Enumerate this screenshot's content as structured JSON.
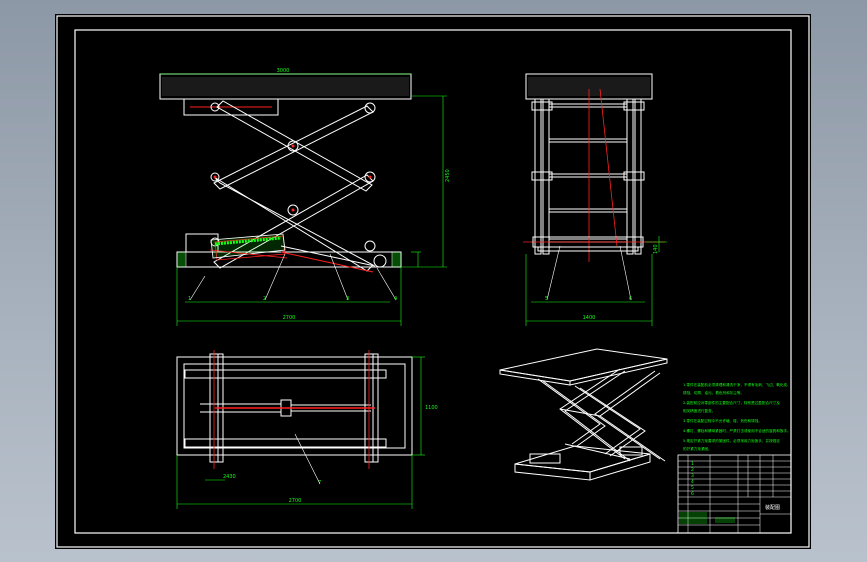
{
  "drawing": {
    "background": "#000000",
    "line_colors": {
      "outline": "#ffffff",
      "dimension": "#14ff14",
      "center": "#ff2020"
    }
  },
  "views": [
    {
      "name": "front-view"
    },
    {
      "name": "side-view"
    },
    {
      "name": "top-view"
    },
    {
      "name": "isometric-view"
    }
  ],
  "balloons": {
    "front": [
      "1",
      "2",
      "3",
      "4"
    ],
    "side": [
      "5",
      "6"
    ],
    "top": [
      "7"
    ]
  },
  "title_block": {
    "title": "装配图",
    "rows": [
      "",
      "",
      "",
      "",
      "",
      ""
    ]
  }
}
